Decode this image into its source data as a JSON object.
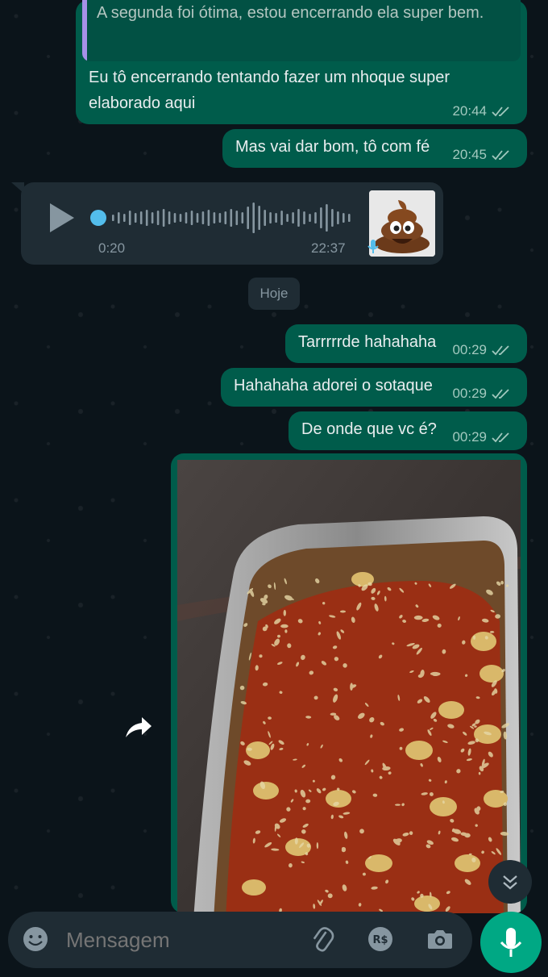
{
  "messages": {
    "m1": {
      "quote": "A segunda foi ótima, estou encerrando ela super bem.",
      "text": "Eu tô encerrando tentando fazer um nhoque super elaborado aqui",
      "time": "20:44"
    },
    "m2": {
      "text": "Mas vai dar bom, tô com fé",
      "time": "20:45"
    },
    "audio": {
      "duration": "0:20",
      "time": "22:37",
      "avatar_emoji": "💩"
    },
    "date_separator": "Hoje",
    "m3": {
      "text": "Tarrrrrde hahahaha",
      "time": "00:29"
    },
    "m4": {
      "text": "Hahahaha adorei o sotaque",
      "time": "00:29"
    },
    "m5": {
      "text": "De onde que vc é?",
      "time": "00:29"
    }
  },
  "photo": {
    "subject": "gnocchi-tray"
  },
  "composer": {
    "placeholder": "Mensagem",
    "icons": [
      "emoji-icon",
      "attach-icon",
      "payment-icon",
      "camera-icon",
      "mic-icon"
    ]
  },
  "colors": {
    "background": "#0b141a",
    "outgoing_bubble": "#005c4b",
    "incoming_bubble": "#1f2c34",
    "accent": "#00a884",
    "read_ticks": "#a3c9bf"
  }
}
